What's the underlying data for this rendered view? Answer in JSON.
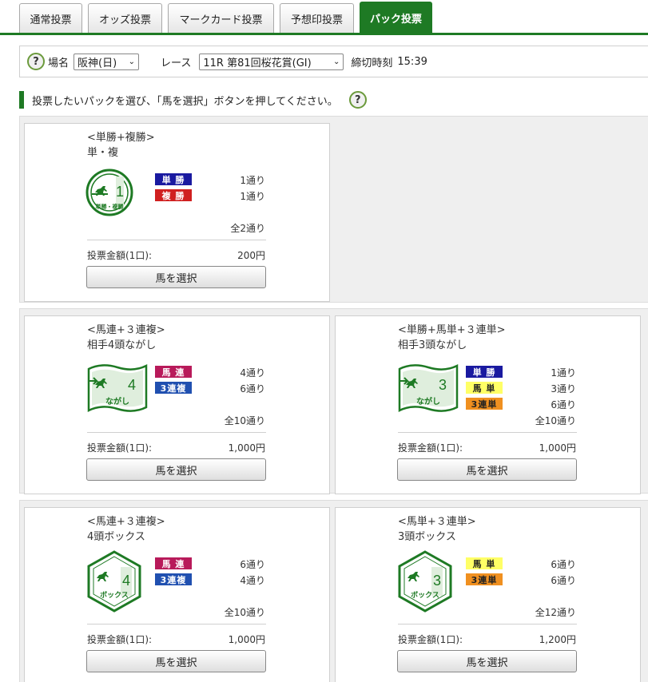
{
  "tabs": [
    {
      "label": "通常投票"
    },
    {
      "label": "オッズ投票"
    },
    {
      "label": "マークカード投票"
    },
    {
      "label": "予想印投票"
    },
    {
      "label": "パック投票"
    }
  ],
  "filter": {
    "venue_label": "場名",
    "venue_value": "阪神(日)",
    "race_label": "レース",
    "race_value": "11R 第81回桜花賞(GI)",
    "deadline_label": "締切時刻",
    "deadline_value": "15:39"
  },
  "instruction": "投票したいパックを選び、「馬を選択」ボタンを押してください。",
  "help_glyph": "?",
  "packs": [
    {
      "title": "<単勝+複勝>",
      "subtitle": "単・複",
      "emblem": {
        "number": "1",
        "text": "単勝・複勝"
      },
      "bets": [
        {
          "type": "単 勝",
          "count": "1通り",
          "color": "#1a1aa0",
          "text_color": "#ffffff"
        },
        {
          "type": "複 勝",
          "count": "1通り",
          "color": "#d02020",
          "text_color": "#ffffff"
        }
      ],
      "total": "全2通り",
      "amount_label": "投票金額(1口):",
      "amount": "200円",
      "button": "馬を選択"
    },
    {
      "title": "<馬連+３連複>",
      "subtitle": "相手4頭ながし",
      "emblem": {
        "number": "4",
        "text": "ながし"
      },
      "bets": [
        {
          "type": "馬 連",
          "count": "4通り",
          "color": "#b81a5a",
          "text_color": "#ffffff"
        },
        {
          "type": "3連複",
          "count": "6通り",
          "color": "#2050b0",
          "text_color": "#ffffff"
        }
      ],
      "total": "全10通り",
      "amount_label": "投票金額(1口):",
      "amount": "1,000円",
      "button": "馬を選択"
    },
    {
      "title": "<単勝+馬単+３連単>",
      "subtitle": "相手3頭ながし",
      "emblem": {
        "number": "3",
        "text": "ながし"
      },
      "bets": [
        {
          "type": "単 勝",
          "count": "1通り",
          "color": "#1a1aa0",
          "text_color": "#ffffff"
        },
        {
          "type": "馬 単",
          "count": "3通り",
          "color": "#ffff66",
          "text_color": "#222222"
        },
        {
          "type": "3連単",
          "count": "6通り",
          "color": "#f09020",
          "text_color": "#222222"
        }
      ],
      "total": "全10通り",
      "amount_label": "投票金額(1口):",
      "amount": "1,000円",
      "button": "馬を選択"
    },
    {
      "title": "<馬連+３連複>",
      "subtitle": "4頭ボックス",
      "emblem": {
        "number": "4",
        "text": "ボックス"
      },
      "bets": [
        {
          "type": "馬 連",
          "count": "6通り",
          "color": "#b81a5a",
          "text_color": "#ffffff"
        },
        {
          "type": "3連複",
          "count": "4通り",
          "color": "#2050b0",
          "text_color": "#ffffff"
        }
      ],
      "total": "全10通り",
      "amount_label": "投票金額(1口):",
      "amount": "1,000円",
      "button": "馬を選択"
    },
    {
      "title": "<馬単+３連単>",
      "subtitle": "3頭ボックス",
      "emblem": {
        "number": "3",
        "text": "ボックス"
      },
      "bets": [
        {
          "type": "馬 単",
          "count": "6通り",
          "color": "#ffff66",
          "text_color": "#222222"
        },
        {
          "type": "3連単",
          "count": "6通り",
          "color": "#f09020",
          "text_color": "#222222"
        }
      ],
      "total": "全12通り",
      "amount_label": "投票金額(1口):",
      "amount": "1,200円",
      "button": "馬を選択"
    }
  ],
  "colors": {
    "accent": "#1e7a24"
  }
}
